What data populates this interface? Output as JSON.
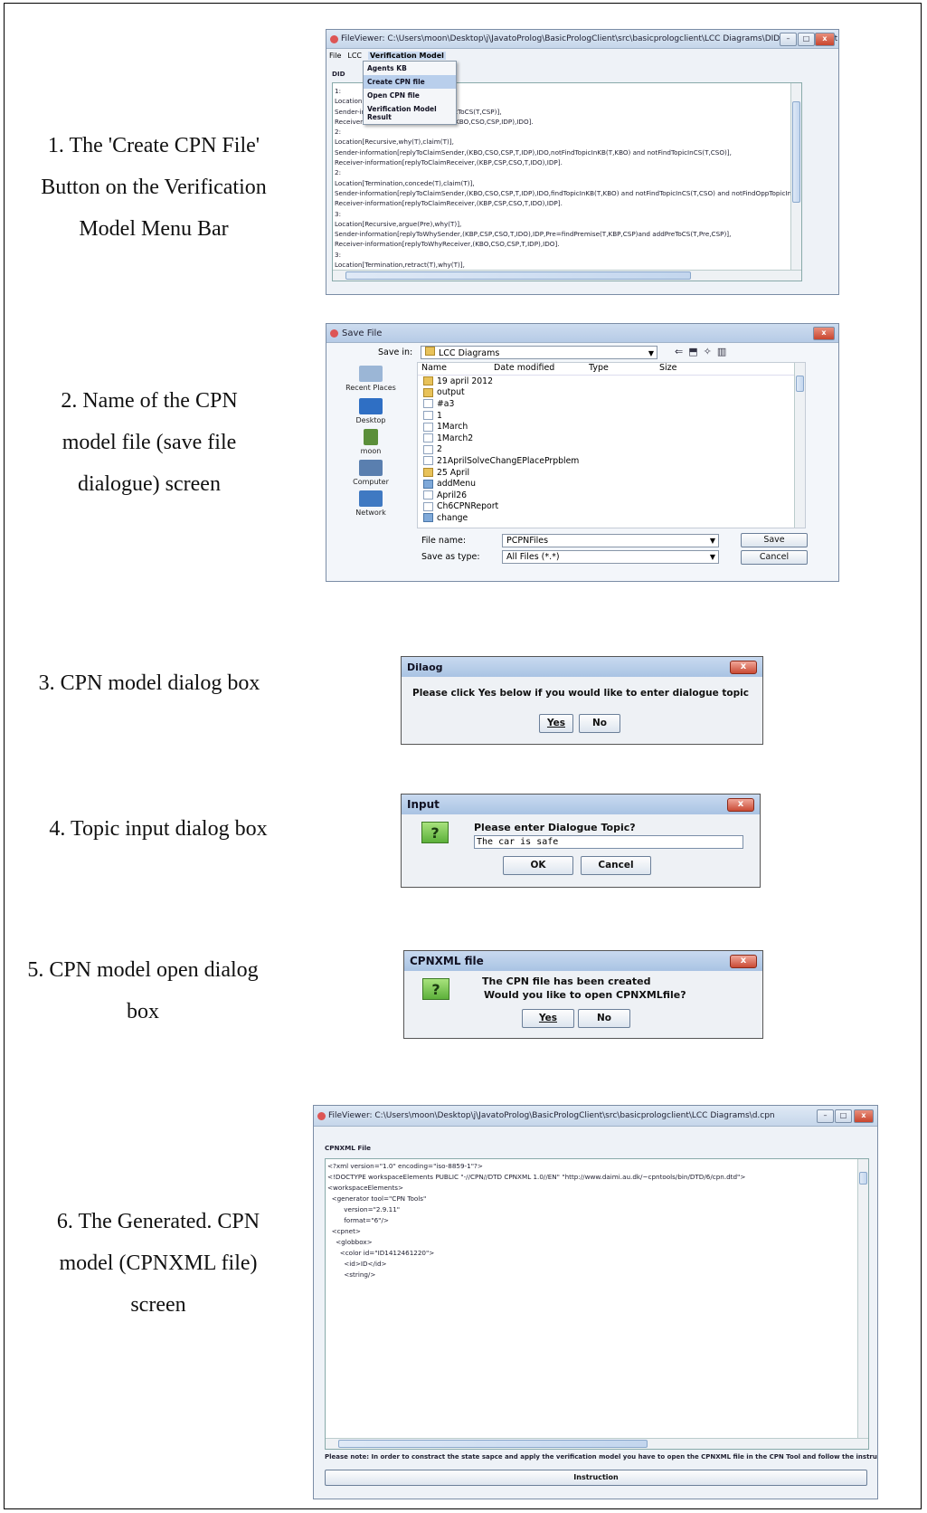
{
  "captions": {
    "c1": [
      "1. The 'Create CPN File'",
      "Button on the Verification",
      "Model Menu Bar"
    ],
    "c2": [
      "2. Name of the CPN",
      "model file (save file",
      "dialogue) screen"
    ],
    "c3": [
      "3. CPN model dialog box"
    ],
    "c4": [
      "4. Topic input dialog box"
    ],
    "c5": [
      "5. CPN model open dialog",
      "box"
    ],
    "c6": [
      "6. The Generated. CPN",
      "model (CPNXML file)",
      "screen"
    ]
  },
  "shot1": {
    "title": "FileViewer: C:\\Users\\moon\\Desktop\\j\\JavatoProlog\\BasicPrologClient\\src\\basicprologclient\\LCC Diagrams\\DIDPersuasion.txt",
    "menu": [
      "File",
      "LCC",
      "Verification Model"
    ],
    "label": "DID",
    "dropdown": [
      "Agents KB",
      "Create CPN file",
      "Open CPN file",
      "Verification Model Result"
    ],
    "lines": [
      "1:",
      "Location[",
      "Sender-in                    SP,CSO,T,IDO),IDP,addTopicToCS(T,CSP)],",
      "Receiver-information[claimReceiver,(KBO,CSO,CSP,IDP),IDO].",
      "2:",
      "Location[Recursive,why(T),claim(T)],",
      "Sender-information[replyToClaimSender,(KBO,CSO,CSP,T,IDP),IDO,notFindTopicInKB(T,KBO) and notFindTopicInCS(T,CSO)],",
      "Receiver-information[replyToClaimReceiver,(KBP,CSP,CSO,T,IDO),IDP].",
      "2:",
      "Location[Termination,concede(T),claim(T)],",
      "Sender-information[replyToClaimSender,(KBO,CSO,CSP,T,IDP),IDO,findTopicInKB(T,KBO) and notFindTopicInCS(T,CSO) and notFindOppTopicInCS",
      "Receiver-information[replyToClaimReceiver,(KBP,CSP,CSO,T,IDO),IDP].",
      "3:",
      "Location[Recursive,argue(Pre),why(T)],",
      "Sender-information[replyToWhySender,(KBP,CSP,CSO,T,IDO),IDP,Pre=findPremise(T,KBP,CSP)and addPreToCS(T,Pre,CSP)],",
      "Receiver-information[replyToWhyReceiver,(KBO,CSO,CSP,T,IDP),IDO].",
      "3:",
      "Location[Termination,retract(T),why(T)],"
    ]
  },
  "shot2": {
    "title": "Save File",
    "save_in_label": "Save in:",
    "save_in_value": "LCC Diagrams",
    "columns": [
      "Name",
      "Date modified",
      "Type",
      "Size"
    ],
    "places": [
      "Recent Places",
      "Desktop",
      "moon",
      "Computer",
      "Network"
    ],
    "files": [
      {
        "name": "19 april 2012",
        "icon": "folder"
      },
      {
        "name": "output",
        "icon": "folder"
      },
      {
        "name": "#a3",
        "icon": "doc"
      },
      {
        "name": "1",
        "icon": "doc"
      },
      {
        "name": "1March",
        "icon": "doc"
      },
      {
        "name": "1March2",
        "icon": "doc"
      },
      {
        "name": "2",
        "icon": "doc"
      },
      {
        "name": "21AprilSolveChangEPlacePrpblem",
        "icon": "doc"
      },
      {
        "name": "25 April",
        "icon": "folder"
      },
      {
        "name": "addMenu",
        "icon": "img"
      },
      {
        "name": "April26",
        "icon": "doc"
      },
      {
        "name": "Ch6CPNReport",
        "icon": "doc"
      },
      {
        "name": "change",
        "icon": "img"
      }
    ],
    "file_name_label": "File name:",
    "file_name_value": "PCPNFiles",
    "save_type_label": "Save as type:",
    "save_type_value": "All Files (*.*)",
    "save_button": "Save",
    "cancel_button": "Cancel"
  },
  "shot3": {
    "title": "Dilaog",
    "message": "Please click Yes below if you would like to enter dialogue topic",
    "yes": "Yes",
    "no": "No"
  },
  "shot4": {
    "title": "Input",
    "prompt": "Please enter Dialogue Topic?",
    "value": "The car is safe",
    "ok": "OK",
    "cancel": "Cancel"
  },
  "shot5": {
    "title": "CPNXML file",
    "line1": "The CPN file has been created",
    "line2": "Would you like to open CPNXMLfile?",
    "yes": "Yes",
    "no": "No"
  },
  "shot6": {
    "title": "FileViewer: C:\\Users\\moon\\Desktop\\j\\JavatoProlog\\BasicPrologClient\\src\\basicprologclient\\LCC Diagrams\\d.cpn",
    "label": "CPNXML File",
    "lines": [
      "<?xml version=\"1.0\" encoding=\"iso-8859-1\"?>",
      "",
      "<!DOCTYPE workspaceElements PUBLIC \"-//CPN//DTD CPNXML 1.0//EN\" \"http://www.daimi.au.dk/~cpntools/bin/DTD/6/cpn.dtd\">",
      "",
      "",
      "",
      "<workspaceElements>",
      "",
      "  <generator tool=\"CPN Tools\"",
      "",
      "        version=\"2.9.11\"",
      "",
      "        format=\"6\"/>",
      "",
      "  <cpnet>",
      "",
      "    <globbox>",
      "",
      "      <color id=\"ID1412461220\">",
      "",
      "        <id>ID</id>",
      "",
      "        <string/>"
    ],
    "note": "Please note: In order to  constract the state sapce and apply the verification model you have to open the CPNXML file in the CPN Tool and follow the instruction provided in:",
    "instruction_button": "Instruction"
  }
}
